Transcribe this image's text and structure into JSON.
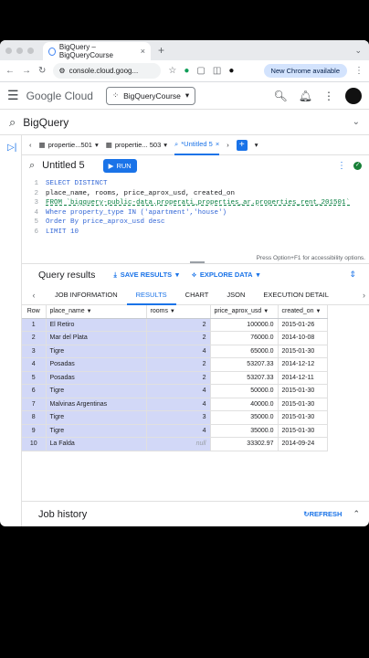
{
  "browser": {
    "tab_title": "BigQuery – BigQueryCourse",
    "url": "console.cloud.goog...",
    "new_chrome_label": "New Chrome available"
  },
  "console": {
    "logo_text": "Google Cloud",
    "project": "BigQueryCourse"
  },
  "product": {
    "title": "BigQuery"
  },
  "editor_tabs": [
    {
      "label": "propertie...501"
    },
    {
      "label": "propertie... 503"
    },
    {
      "label": "*Untitled 5"
    }
  ],
  "query": {
    "title": "Untitled 5",
    "run_label": "RUN",
    "lines": [
      {
        "n": "1",
        "text": "SELECT DISTINCT"
      },
      {
        "n": "2",
        "text": "place_name, rooms, price_aprox_usd, created_on"
      },
      {
        "n": "3",
        "text": "FROM `bigquery-public-data.properati_properties_ar.properties_rent_201501`"
      },
      {
        "n": "4",
        "text": "Where property_type IN ('apartment','house')"
      },
      {
        "n": "5",
        "text": "Order By price_aprox_usd desc"
      },
      {
        "n": "6",
        "text": "LIMIT 10"
      }
    ],
    "accessibility_hint": "Press Option+F1 for accessibility options."
  },
  "results": {
    "title": "Query results",
    "save_label": "SAVE RESULTS",
    "explore_label": "EXPLORE DATA",
    "tabs": [
      "JOB INFORMATION",
      "RESULTS",
      "CHART",
      "JSON",
      "EXECUTION DETAIL"
    ],
    "columns": [
      "Row",
      "place_name",
      "rooms",
      "price_aprox_usd",
      "created_on"
    ],
    "rows": [
      {
        "row": "1",
        "place_name": "El Retiro",
        "rooms": "2",
        "price": "100000.0",
        "created_on": "2015-01-26"
      },
      {
        "row": "2",
        "place_name": "Mar del Plata",
        "rooms": "2",
        "price": "76000.0",
        "created_on": "2014-10-08"
      },
      {
        "row": "3",
        "place_name": "Tigre",
        "rooms": "4",
        "price": "65000.0",
        "created_on": "2015-01-30"
      },
      {
        "row": "4",
        "place_name": "Posadas",
        "rooms": "2",
        "price": "53207.33",
        "created_on": "2014-12-12"
      },
      {
        "row": "5",
        "place_name": "Posadas",
        "rooms": "2",
        "price": "53207.33",
        "created_on": "2014-12-11"
      },
      {
        "row": "6",
        "place_name": "Tigre",
        "rooms": "4",
        "price": "50000.0",
        "created_on": "2015-01-30"
      },
      {
        "row": "7",
        "place_name": "Malvinas Argentinas",
        "rooms": "4",
        "price": "40000.0",
        "created_on": "2015-01-30"
      },
      {
        "row": "8",
        "place_name": "Tigre",
        "rooms": "3",
        "price": "35000.0",
        "created_on": "2015-01-30"
      },
      {
        "row": "9",
        "place_name": "Tigre",
        "rooms": "4",
        "price": "35000.0",
        "created_on": "2015-01-30"
      },
      {
        "row": "10",
        "place_name": "La Falda",
        "rooms": "null",
        "price": "33302.97",
        "created_on": "2014-09-24"
      }
    ]
  },
  "job_history": {
    "title": "Job history",
    "refresh_label": "REFRESH"
  }
}
